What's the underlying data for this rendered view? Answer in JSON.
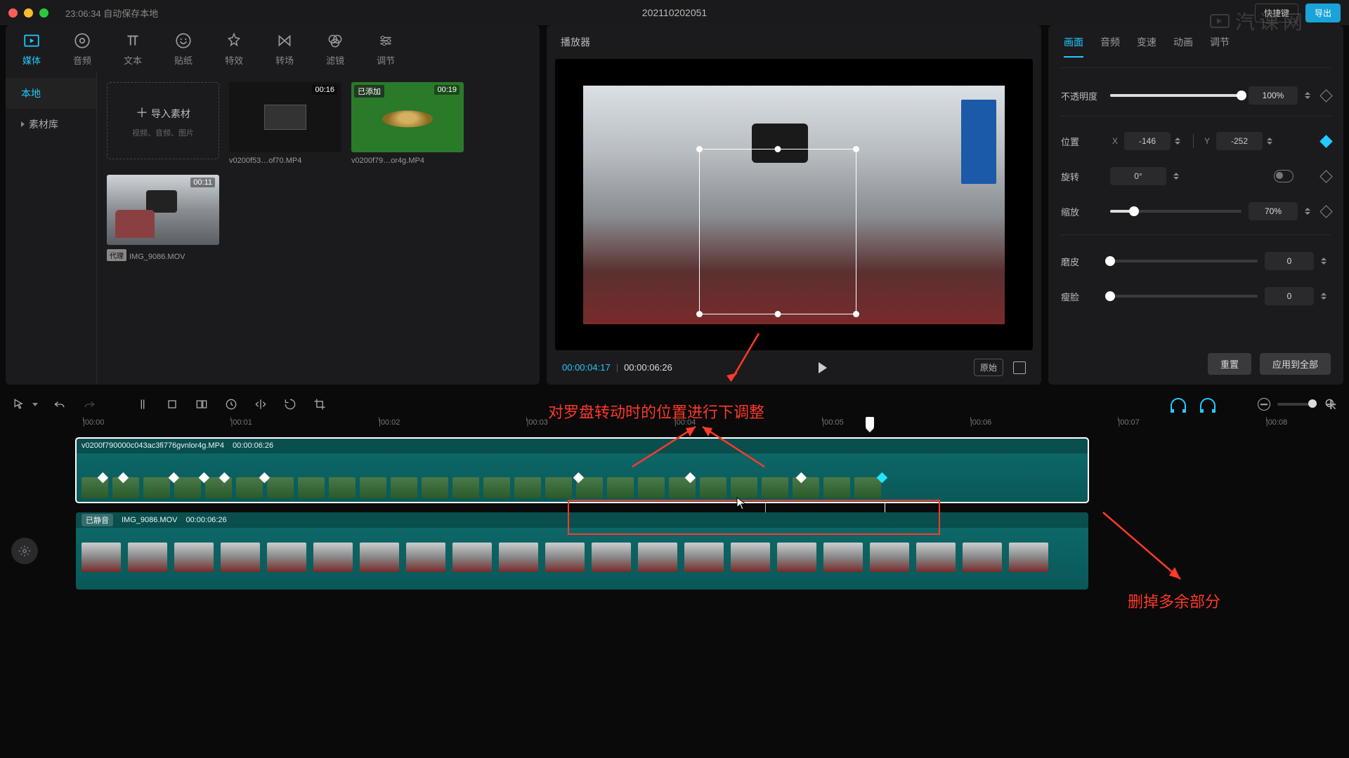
{
  "titlebar": {
    "autosave": "23:06:34 自动保存本地",
    "project": "202110202051",
    "shortcut_btn": "快捷键",
    "export_btn": "导出",
    "watermark": "汽课网"
  },
  "tool_tabs": [
    {
      "id": "media",
      "label": "媒体"
    },
    {
      "id": "audio",
      "label": "音频"
    },
    {
      "id": "text",
      "label": "文本"
    },
    {
      "id": "sticker",
      "label": "贴纸"
    },
    {
      "id": "effect",
      "label": "特效"
    },
    {
      "id": "transition",
      "label": "转场"
    },
    {
      "id": "filter",
      "label": "滤镜"
    },
    {
      "id": "adjust",
      "label": "调节"
    }
  ],
  "media_side": [
    {
      "label": "本地",
      "active": true
    },
    {
      "label": "素材库",
      "active": false,
      "chev": true
    }
  ],
  "import": {
    "label": "导入素材",
    "hint": "视频、音频、图片"
  },
  "clips": [
    {
      "dur": "00:16",
      "name": "v0200f53…of70.MP4",
      "kind": "dark"
    },
    {
      "dur": "00:19",
      "name": "v0200f79…or4g.MP4",
      "kind": "green",
      "tag": "已添加"
    },
    {
      "dur": "00:11",
      "name": "IMG_9086.MOV",
      "kind": "video",
      "proxy": "代理"
    }
  ],
  "preview": {
    "title": "播放器",
    "tc_current": "00:00:04:17",
    "tc_total": "00:00:06:26",
    "ratio_btn": "原始"
  },
  "inspector": {
    "tabs": [
      "画面",
      "音频",
      "变速",
      "动画",
      "调节"
    ],
    "opacity": {
      "label": "不透明度",
      "value": "100%",
      "pct": 100
    },
    "position": {
      "label": "位置",
      "x": "-146",
      "y": "-252"
    },
    "rotation": {
      "label": "旋转",
      "value": "0°"
    },
    "scale": {
      "label": "缩放",
      "value": "70%",
      "pct": 18
    },
    "smooth": {
      "label": "磨皮",
      "value": "0",
      "pct": 0
    },
    "face": {
      "label": "瘦脸",
      "value": "0",
      "pct": 0
    },
    "reset": "重置",
    "apply_all": "应用到全部"
  },
  "ruler_ticks": [
    "00:00",
    "00:01",
    "00:02",
    "00:03",
    "00:04",
    "00:05",
    "00:06",
    "00:07",
    "00:08"
  ],
  "track1": {
    "name": "v0200f790000c043ac3fi776gvnlor4g.MP4",
    "dur": "00:00:06:26"
  },
  "track2": {
    "mute": "已静音",
    "name": "IMG_9086.MOV",
    "dur": "00:00:06:26"
  },
  "annotations": {
    "a1": "对罗盘转动时的位置进行下调整",
    "a2": "删掉多余部分"
  }
}
